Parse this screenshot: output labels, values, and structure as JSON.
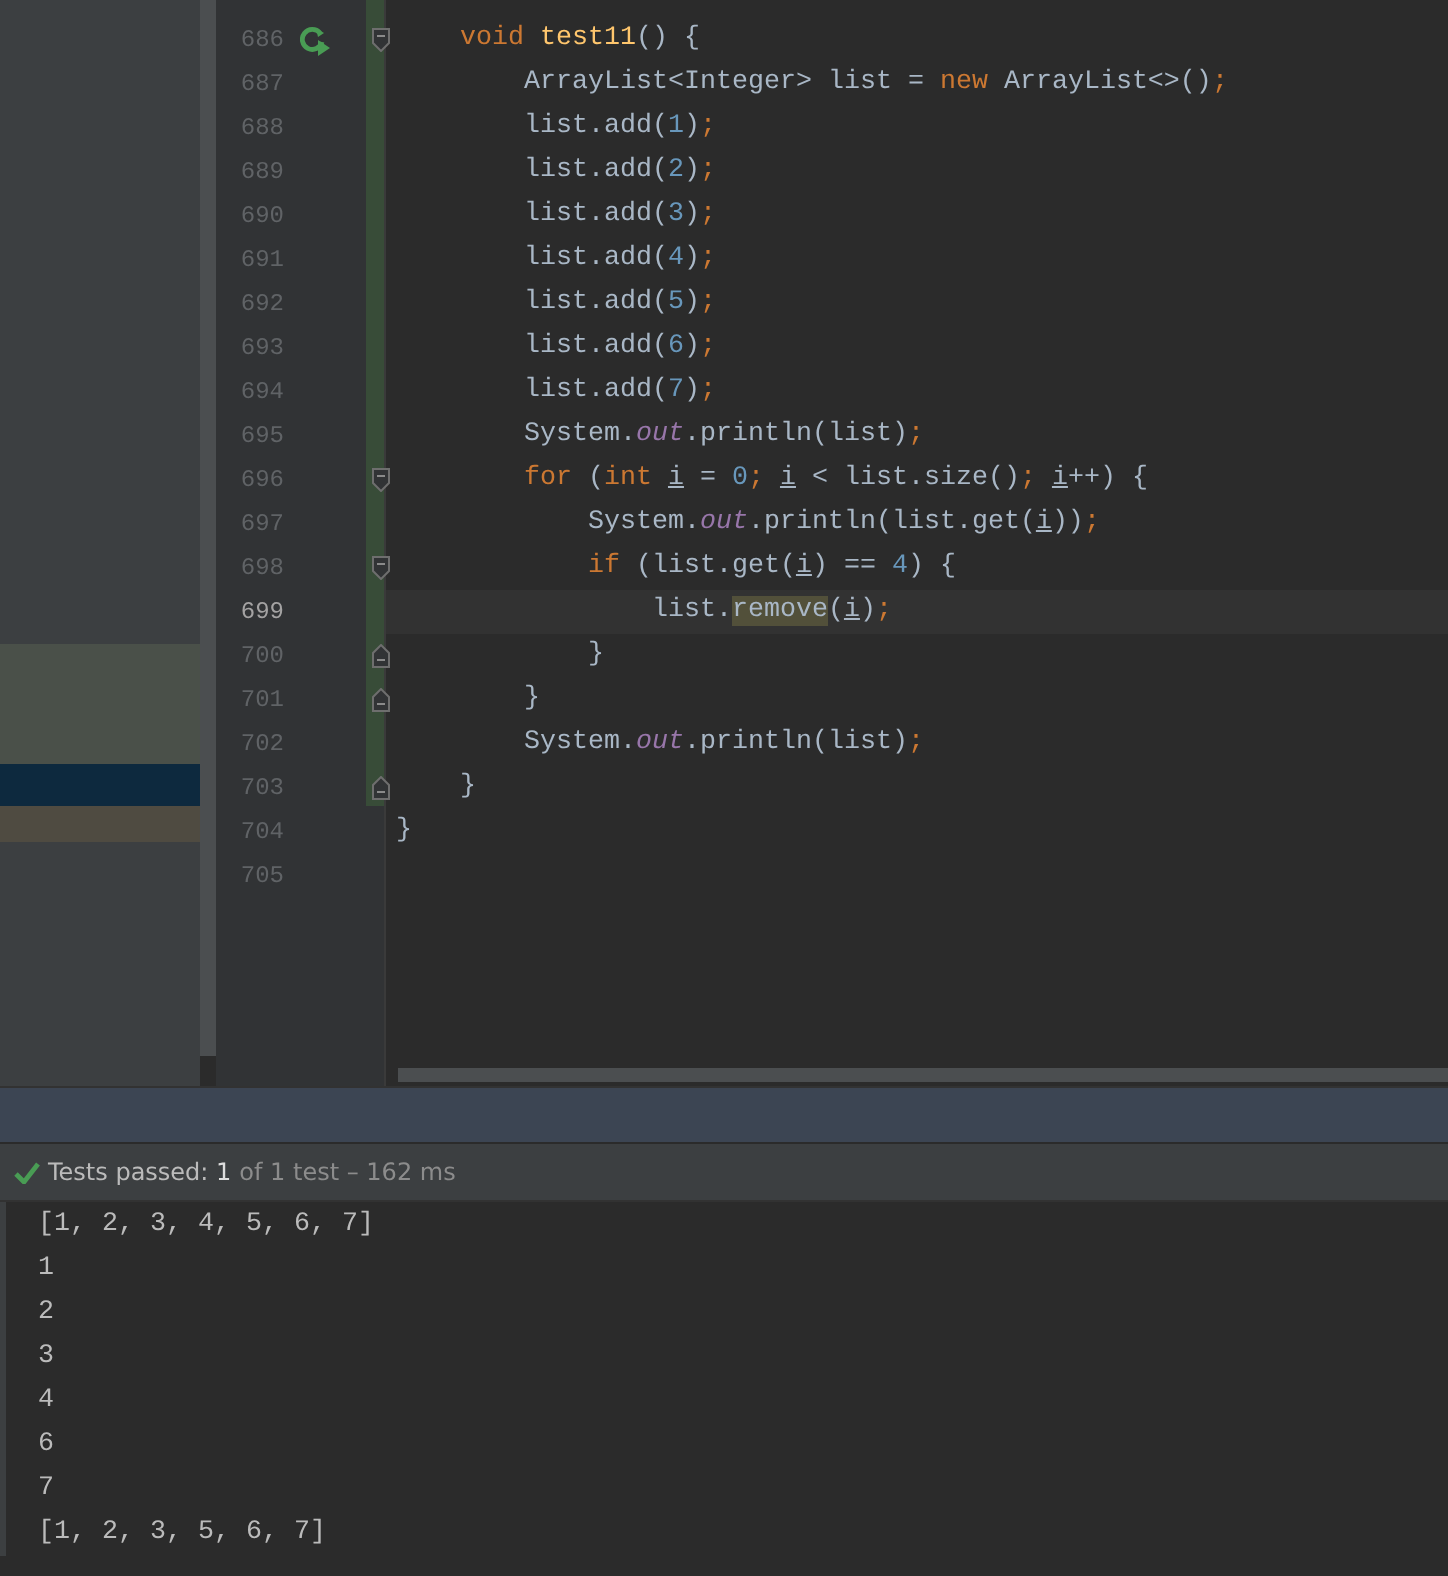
{
  "editor": {
    "lines": [
      {
        "number": "686",
        "current": false,
        "run_icon": true,
        "fold_start": true,
        "tokens": [
          {
            "text": "    void ",
            "kind": "keyword"
          },
          {
            "text": "test11",
            "kind": "declaration"
          },
          {
            "text": "() {"
          }
        ]
      },
      {
        "number": "687",
        "current": false,
        "tokens": [
          {
            "text": "        ArrayList<Integer> list = "
          },
          {
            "text": "new ",
            "kind": "keyword"
          },
          {
            "text": "ArrayList<>()"
          },
          {
            "text": ";",
            "kind": "semicolon"
          }
        ]
      },
      {
        "number": "688",
        "current": false,
        "tokens": [
          {
            "text": "        list.add("
          },
          {
            "text": "1",
            "kind": "number"
          },
          {
            "text": ")"
          },
          {
            "text": ";",
            "kind": "semicolon"
          }
        ]
      },
      {
        "number": "689",
        "current": false,
        "tokens": [
          {
            "text": "        list.add("
          },
          {
            "text": "2",
            "kind": "number"
          },
          {
            "text": ")"
          },
          {
            "text": ";",
            "kind": "semicolon"
          }
        ]
      },
      {
        "number": "690",
        "current": false,
        "tokens": [
          {
            "text": "        list.add("
          },
          {
            "text": "3",
            "kind": "number"
          },
          {
            "text": ")"
          },
          {
            "text": ";",
            "kind": "semicolon"
          }
        ]
      },
      {
        "number": "691",
        "current": false,
        "tokens": [
          {
            "text": "        list.add("
          },
          {
            "text": "4",
            "kind": "number"
          },
          {
            "text": ")"
          },
          {
            "text": ";",
            "kind": "semicolon"
          }
        ]
      },
      {
        "number": "692",
        "current": false,
        "tokens": [
          {
            "text": "        list.add("
          },
          {
            "text": "5",
            "kind": "number"
          },
          {
            "text": ")"
          },
          {
            "text": ";",
            "kind": "semicolon"
          }
        ]
      },
      {
        "number": "693",
        "current": false,
        "tokens": [
          {
            "text": "        list.add("
          },
          {
            "text": "6",
            "kind": "number"
          },
          {
            "text": ")"
          },
          {
            "text": ";",
            "kind": "semicolon"
          }
        ]
      },
      {
        "number": "694",
        "current": false,
        "tokens": [
          {
            "text": "        list.add("
          },
          {
            "text": "7",
            "kind": "number"
          },
          {
            "text": ")"
          },
          {
            "text": ";",
            "kind": "semicolon"
          }
        ]
      },
      {
        "number": "695",
        "current": false,
        "tokens": [
          {
            "text": "        System."
          },
          {
            "text": "out",
            "kind": "static"
          },
          {
            "text": ".println(list)"
          },
          {
            "text": ";",
            "kind": "semicolon"
          }
        ]
      },
      {
        "number": "696",
        "current": false,
        "fold_start": true,
        "tokens": [
          {
            "text": "        for ",
            "kind": "keyword"
          },
          {
            "text": "("
          },
          {
            "text": "int ",
            "kind": "keyword"
          },
          {
            "text": "i",
            "kind": "variable"
          },
          {
            "text": " = "
          },
          {
            "text": "0",
            "kind": "number"
          },
          {
            "text": "; ",
            "kind": "semicolon"
          },
          {
            "text": "i",
            "kind": "variable"
          },
          {
            "text": " < list.size()"
          },
          {
            "text": "; ",
            "kind": "semicolon"
          },
          {
            "text": "i",
            "kind": "variable"
          },
          {
            "text": "++) {"
          }
        ]
      },
      {
        "number": "697",
        "current": false,
        "tokens": [
          {
            "text": "            System."
          },
          {
            "text": "out",
            "kind": "static"
          },
          {
            "text": ".println(list.get("
          },
          {
            "text": "i",
            "kind": "variable"
          },
          {
            "text": "))"
          },
          {
            "text": ";",
            "kind": "semicolon"
          }
        ]
      },
      {
        "number": "698",
        "current": false,
        "fold_start": true,
        "tokens": [
          {
            "text": "            if ",
            "kind": "keyword"
          },
          {
            "text": "(list.get("
          },
          {
            "text": "i",
            "kind": "variable"
          },
          {
            "text": ") == "
          },
          {
            "text": "4",
            "kind": "number"
          },
          {
            "text": ") {"
          }
        ]
      },
      {
        "number": "699",
        "current": true,
        "tokens": [
          {
            "text": "                list."
          },
          {
            "text": "remove",
            "kind": "match"
          },
          {
            "text": "("
          },
          {
            "text": "i",
            "kind": "variable"
          },
          {
            "text": ")"
          },
          {
            "text": ";",
            "kind": "semicolon"
          }
        ]
      },
      {
        "number": "700",
        "current": false,
        "fold_end": true,
        "tokens": [
          {
            "text": "            }"
          }
        ]
      },
      {
        "number": "701",
        "current": false,
        "fold_end": true,
        "tokens": [
          {
            "text": "        }"
          }
        ]
      },
      {
        "number": "702",
        "current": false,
        "tokens": [
          {
            "text": "        System."
          },
          {
            "text": "out",
            "kind": "static"
          },
          {
            "text": ".println(list)"
          },
          {
            "text": ";",
            "kind": "semicolon"
          }
        ]
      },
      {
        "number": "703",
        "current": false,
        "fold_end": true,
        "tokens": [
          {
            "text": "    }"
          }
        ]
      },
      {
        "number": "704",
        "current": false,
        "tokens": [
          {
            "text": "}"
          }
        ]
      },
      {
        "number": "705",
        "current": false
      }
    ]
  },
  "test_status": {
    "passed": true,
    "summary": "Tests passed: ",
    "count": "1",
    "detail": "of 1 test – 162 ms"
  },
  "console": [
    "[1, 2, 3, 4, 5, 6, 7]",
    "1",
    "2",
    "3",
    "4",
    "6",
    "7",
    "[1, 2, 3, 5, 6, 7]"
  ]
}
